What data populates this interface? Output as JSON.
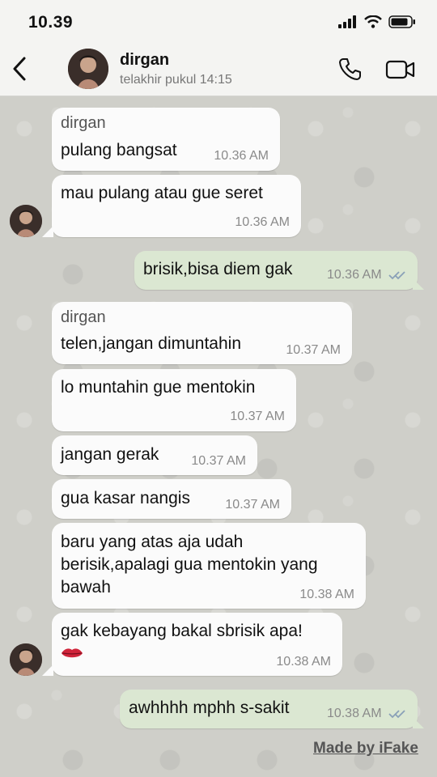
{
  "status_bar": {
    "time": "10.39"
  },
  "header": {
    "name": "dirgan",
    "status": "telakhir pukul 14:15"
  },
  "messages": [
    {
      "sender": "dirgan",
      "text": "pulang bangsat",
      "time": "10.36 AM"
    },
    {
      "text": "mau pulang atau gue seret",
      "time": "10.36 AM"
    },
    {
      "text": "brisik,bisa diem gak",
      "time": "10.36 AM"
    },
    {
      "sender": "dirgan",
      "text": "telen,jangan dimuntahin",
      "time": "10.37 AM"
    },
    {
      "text": "lo muntahin gue mentokin",
      "time": "10.37 AM"
    },
    {
      "text": "jangan gerak",
      "time": "10.37 AM"
    },
    {
      "text": "gua kasar nangis",
      "time": "10.37 AM"
    },
    {
      "line1": "baru yang atas aja udah",
      "line2": "berisik,apalagi gua mentokin yang",
      "line3": "bawah",
      "time": "10.38 AM"
    },
    {
      "text": "gak kebayang bakal sbrisik apa!",
      "time": "10.38 AM"
    },
    {
      "text": "awhhhh mphh s-sakit",
      "time": "10.38 AM"
    }
  ],
  "footer": {
    "watermark": "Made by iFake"
  },
  "colors": {
    "incoming": "#fbfbfb",
    "outgoing": "#dbe7d2",
    "ticks": "#8aa0b8"
  },
  "icons": [
    "signal-icon",
    "wifi-icon",
    "battery-icon",
    "back-icon",
    "phone-icon",
    "video-icon",
    "lips-emoji-icon",
    "read-ticks-icon"
  ]
}
